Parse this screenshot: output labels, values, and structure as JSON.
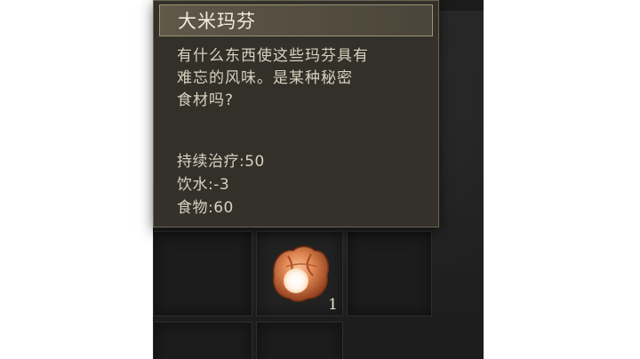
{
  "tooltip": {
    "title": "大米玛芬",
    "description_lines": [
      "有什么东西使这些玛芬具有",
      "难忘的风味。是某种秘密",
      "食材吗?"
    ],
    "stats": [
      {
        "label": "持续治疗:",
        "value": "50"
      },
      {
        "label": "饮水:",
        "value": "-3"
      },
      {
        "label": "食物:",
        "value": "60"
      }
    ]
  },
  "inventory": {
    "item": {
      "icon": "rice-muffin-icon",
      "count": "1"
    }
  },
  "colors": {
    "tooltip_background": "#35322b",
    "tooltip_border": "#6d6452",
    "text": "#d9d1bf",
    "title_text": "#f1ece0",
    "slot_background": "#1c1c1c"
  }
}
